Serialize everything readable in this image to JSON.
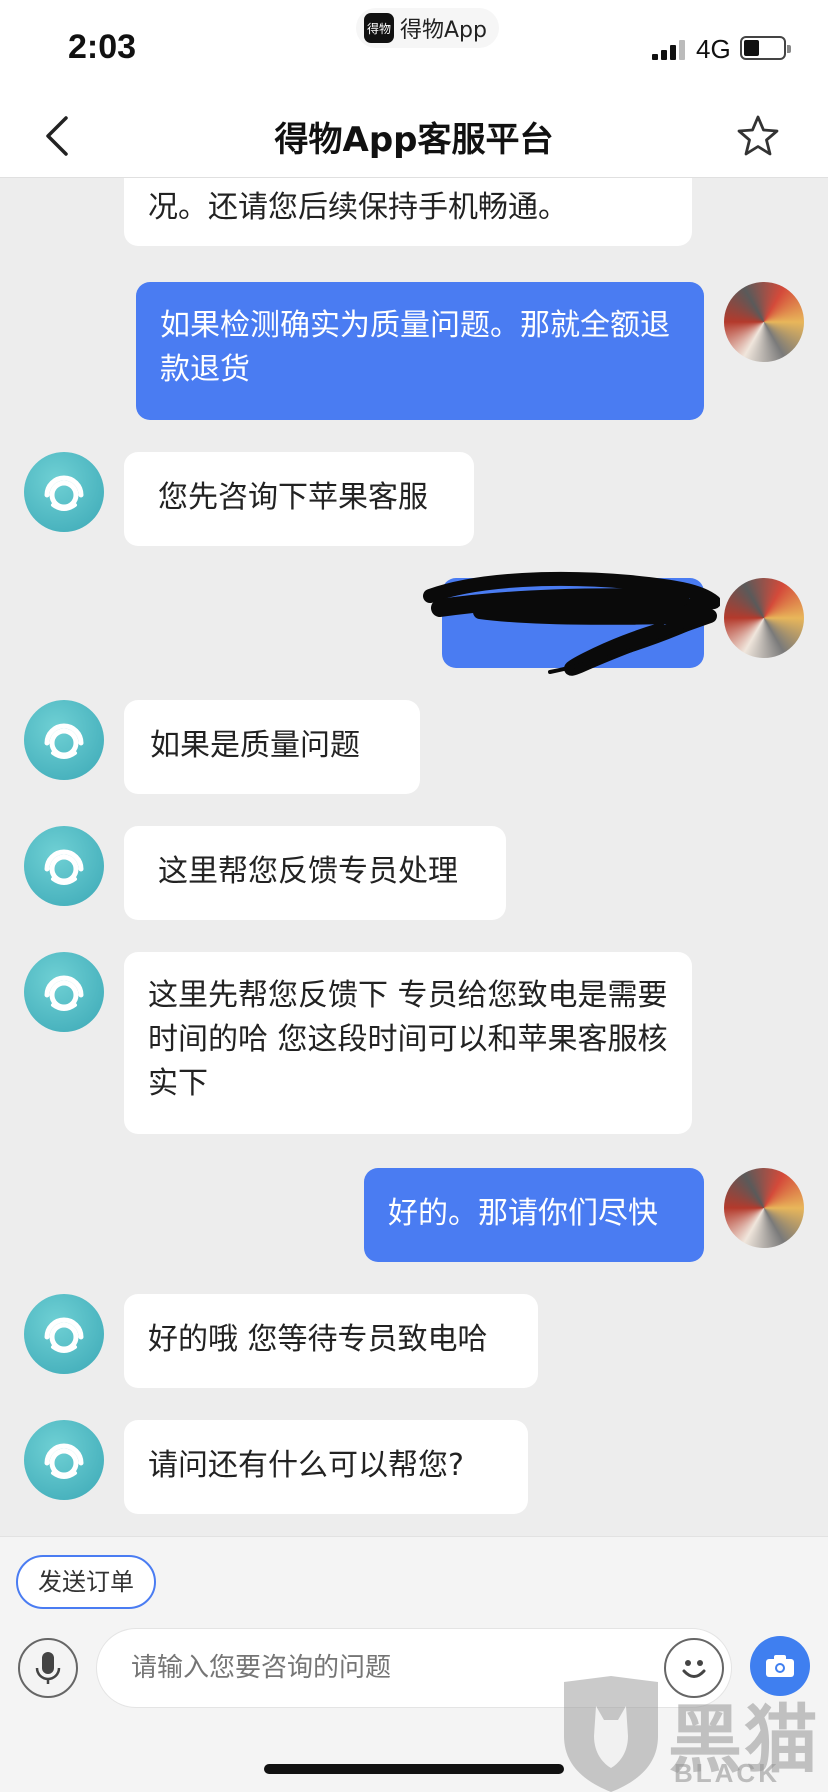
{
  "status_bar": {
    "time": "2:03",
    "app_name": "得物App",
    "network": "4G",
    "battery_level": 0.4
  },
  "nav": {
    "title": "得物App客服平台",
    "back_icon": "chevron-left-icon",
    "favorite_icon": "star-outline-icon"
  },
  "messages": [
    {
      "side": "in",
      "text": "况。还请您后续保持手机畅通。",
      "avatar": false
    },
    {
      "side": "out",
      "text": "如果检测确实为质量问题。那就全额退款退货"
    },
    {
      "side": "in",
      "text": "您先咨询下苹果客服"
    },
    {
      "side": "out",
      "text": "",
      "redacted": true
    },
    {
      "side": "in",
      "text": " 如果是质量问题"
    },
    {
      "side": "in",
      "text": "这里帮您反馈专员处理"
    },
    {
      "side": "in",
      "text": "这里先帮您反馈下 专员给您致电是需要时间的哈 您这段时间可以和苹果客服核实下"
    },
    {
      "side": "out",
      "text": "好的。那请你们尽快"
    },
    {
      "side": "in",
      "text": "好的哦 您等待专员致电哈"
    },
    {
      "side": "in",
      "text": "请问还有什么可以帮您?"
    }
  ],
  "toolbar": {
    "send_order_label": "发送订单"
  },
  "composer": {
    "placeholder": "请输入您要咨询的问题",
    "mic_icon": "microphone-icon",
    "emoji_icon": "emoji-icon",
    "camera_icon": "camera-icon"
  },
  "watermark": {
    "cn": "黑猫",
    "en": "BLACK CAT"
  },
  "colors": {
    "outgoing_bubble": "#4a7cf2",
    "incoming_bubble": "#ffffff",
    "agent_avatar": "#4fbcc6",
    "chat_background": "#ededed"
  }
}
